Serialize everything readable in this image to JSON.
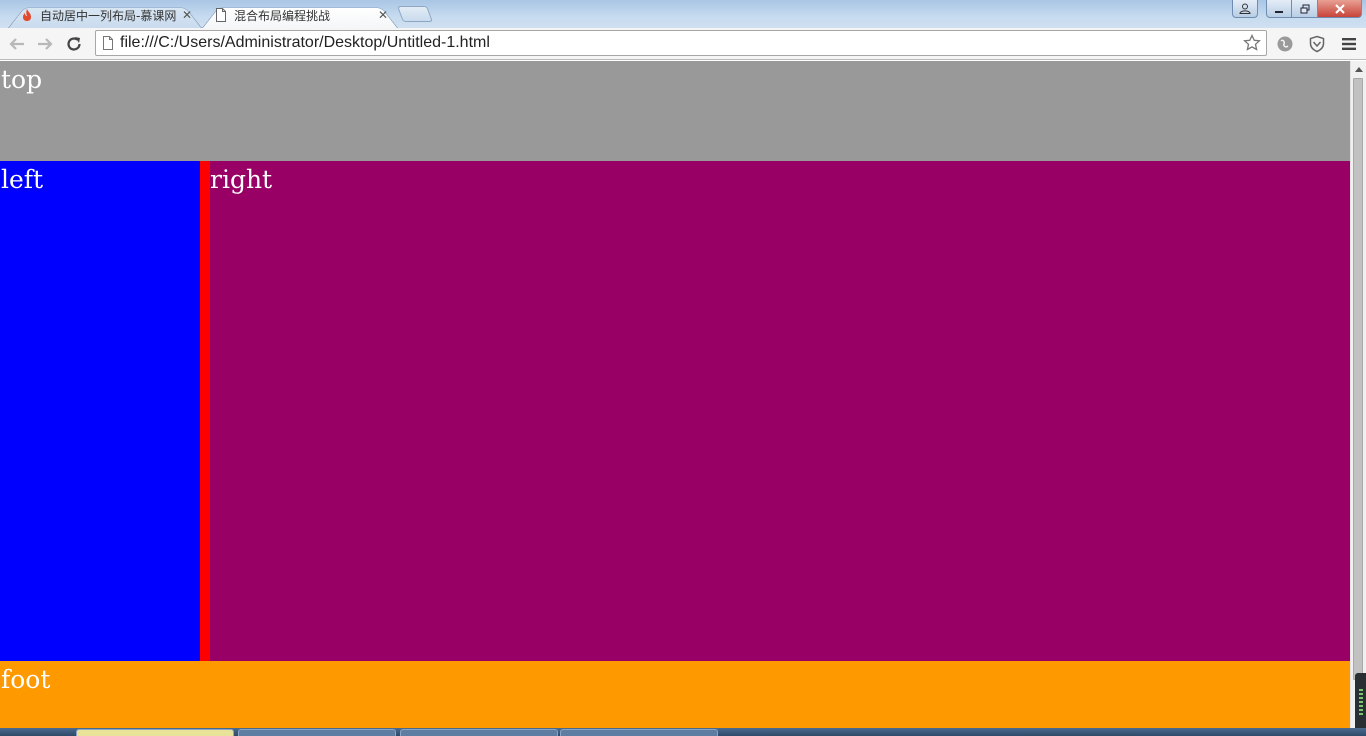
{
  "browser": {
    "tabs": [
      {
        "title": "自动居中一列布局-慕课网",
        "icon": "flame-icon",
        "active": false
      },
      {
        "title": "混合布局编程挑战",
        "icon": "page-icon",
        "active": true
      }
    ],
    "address_bar": {
      "url": "file:///C:/Users/Administrator/Desktop/Untitled-1.html"
    }
  },
  "page": {
    "top": {
      "label": "top",
      "color": "#999999"
    },
    "left": {
      "label": "left",
      "color": "#0000ff"
    },
    "gap": {
      "color": "#ff0000"
    },
    "right": {
      "label": "right",
      "color": "#990066"
    },
    "foot": {
      "label": "foot",
      "color": "#ff9900"
    }
  },
  "colors": {
    "tabstrip": "#c7dbef",
    "close_button": "#c7443a"
  }
}
